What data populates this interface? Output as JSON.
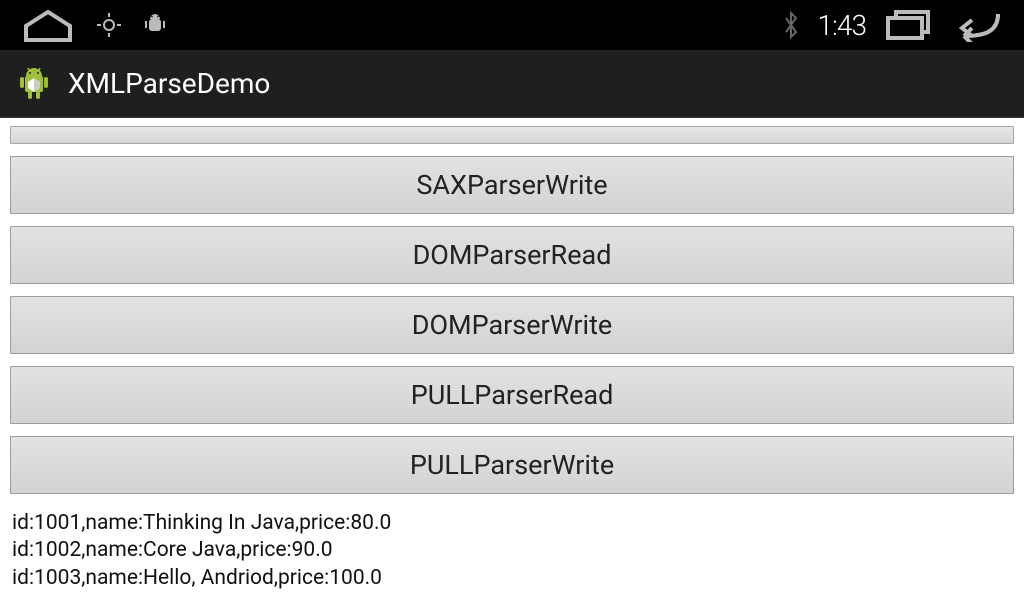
{
  "status_bar": {
    "clock": "1:43"
  },
  "action_bar": {
    "title": "XMLParseDemo"
  },
  "buttons": [
    {
      "label": "SAXParserWrite",
      "name": "sax-parser-write-button"
    },
    {
      "label": "DOMParserRead",
      "name": "dom-parser-read-button"
    },
    {
      "label": "DOMParserWrite",
      "name": "dom-parser-write-button"
    },
    {
      "label": "PULLParserRead",
      "name": "pull-parser-read-button"
    },
    {
      "label": "PULLParserWrite",
      "name": "pull-parser-write-button"
    }
  ],
  "output_lines": [
    "id:1001,name:Thinking In Java,price:80.0",
    "id:1002,name:Core Java,price:90.0",
    "id:1003,name:Hello, Andriod,price:100.0"
  ]
}
